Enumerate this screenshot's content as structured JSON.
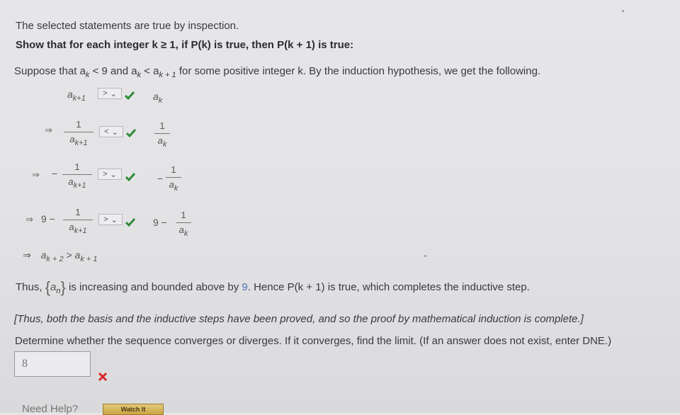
{
  "intro": "The selected statements are true by inspection.",
  "heading": "Show that for each integer k ≥ 1, if P(k) is true, then P(k + 1) is true:",
  "suppose": {
    "pre": "Suppose that a",
    "sub_k": "k",
    "mid1": " < 9 and a",
    "mid2": " < a",
    "sub_k1": "k + 1",
    "post": " for some positive integer k. By the induction hypothesis, we get the following."
  },
  "rows": [
    {
      "lhs": "a",
      "lhs_sub": "k+1",
      "select": ">",
      "rhs": "a",
      "rhs_sub": "k"
    },
    {
      "arrow": "⇒",
      "num": "1",
      "den": "a",
      "den_sub": "k+1",
      "select": "<",
      "rhs_num": "1",
      "rhs_den": "a",
      "rhs_den_sub": "k"
    },
    {
      "arrow": "⇒",
      "minus": "−",
      "num": "1",
      "den": "a",
      "den_sub": "k+1",
      "select": ">",
      "rhs_minus": "−",
      "rhs_num": "1",
      "rhs_den": "a",
      "rhs_den_sub": "k"
    },
    {
      "arrow": "⇒",
      "prefix": "9 −",
      "num": "1",
      "den": "a",
      "den_sub": "k+1",
      "select": ">",
      "rhs_prefix": "9 −",
      "rhs_num": "1",
      "rhs_den": "a",
      "rhs_den_sub": "k"
    }
  ],
  "final_row": {
    "arrow": "⇒",
    "a1": "a",
    "s1": "k + 2",
    "op": " > ",
    "a2": "a",
    "s2": "k + 1"
  },
  "thus": {
    "pre": "Thus, ",
    "set_a": "a",
    "set_sub": "n",
    "mid": " is increasing and bounded above by ",
    "bound": "9",
    "post": ". Hence P(k + 1) is true, which completes the inductive step."
  },
  "conclusion": "[Thus, both the basis and the inductive steps have been proved, and so the proof by mathematical induction is complete.]",
  "question": "Determine whether the sequence converges or diverges. If it converges, find the limit. (If an answer does not exist, enter DNE.)",
  "answer_value": "8",
  "need_help": "Need Help?",
  "watch_it": "Watch It",
  "colors": {
    "check": "#2e8b3a",
    "xmark": "#d8282e",
    "bound": "#4a6fb0"
  }
}
